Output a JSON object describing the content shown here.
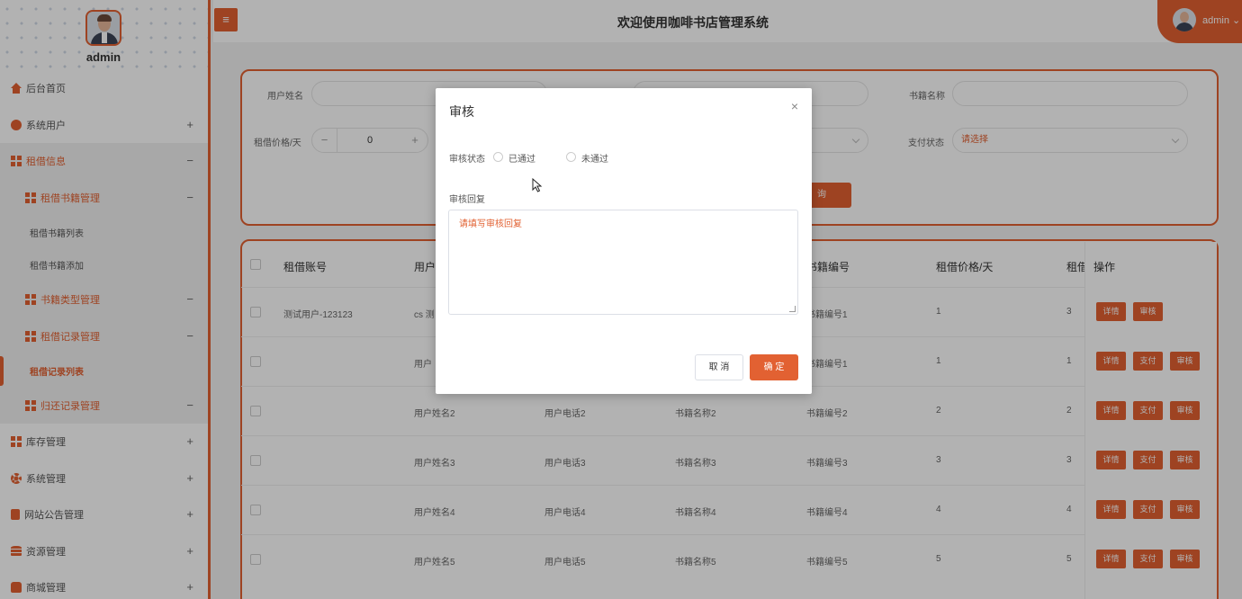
{
  "header": {
    "title": "欢迎使用咖啡书店管理系统",
    "user": "admin",
    "user_caret": "⌄",
    "menu_icon": "≡"
  },
  "sidebar": {
    "username": "admin",
    "items": [
      {
        "label": "后台首页",
        "icon": "home-icon",
        "toggle": ""
      },
      {
        "label": "系统用户",
        "icon": "user-icon",
        "toggle": "+"
      },
      {
        "label": "租借信息",
        "icon": "grid-icon",
        "toggle": "−"
      },
      {
        "label": "租借书籍管理",
        "icon": "grid-icon",
        "toggle": "−"
      },
      {
        "label": "租借书籍列表",
        "icon": "",
        "toggle": ""
      },
      {
        "label": "租借书籍添加",
        "icon": "",
        "toggle": ""
      },
      {
        "label": "书籍类型管理",
        "icon": "grid-icon",
        "toggle": "−"
      },
      {
        "label": "租借记录管理",
        "icon": "grid-icon",
        "toggle": "−"
      },
      {
        "label": "租借记录列表",
        "icon": "",
        "toggle": ""
      },
      {
        "label": "归还记录管理",
        "icon": "grid-icon",
        "toggle": "−"
      },
      {
        "label": "库存管理",
        "icon": "grid-icon",
        "toggle": "+"
      },
      {
        "label": "系统管理",
        "icon": "gear-icon",
        "toggle": "+"
      },
      {
        "label": "网站公告管理",
        "icon": "document-icon",
        "toggle": "+"
      },
      {
        "label": "资源管理",
        "icon": "database-icon",
        "toggle": "+"
      },
      {
        "label": "商城管理",
        "icon": "shop-icon",
        "toggle": "+"
      }
    ]
  },
  "search": {
    "user_name_label": "用户姓名",
    "book_name_label": "书籍名称",
    "price_label": "租借价格/天",
    "price_value": "0",
    "minus": "−",
    "plus": "+",
    "pay_status_label": "支付状态",
    "pay_status_placeholder": "请选择",
    "search_button": "询"
  },
  "table": {
    "columns": [
      "租借账号",
      "用户",
      "书籍编号",
      "租借价格/天",
      "租借",
      "操作"
    ],
    "rows": [
      {
        "account": "测试用户-123123",
        "user": "cs 测",
        "book_no": "书籍编号1",
        "price": "1",
        "days": "3",
        "phone": "",
        "book_name": "",
        "buttons": [
          "详情",
          "审核"
        ]
      },
      {
        "account": "",
        "user": "用户",
        "book_no": "书籍编号1",
        "price": "1",
        "days": "1",
        "phone": "",
        "book_name": "",
        "buttons": [
          "详情",
          "支付",
          "审核"
        ]
      },
      {
        "account": "",
        "user": "用户姓名2",
        "phone": "用户电话2",
        "book_name": "书籍名称2",
        "book_no": "书籍编号2",
        "price": "2",
        "days": "2",
        "buttons": [
          "详情",
          "支付",
          "审核"
        ]
      },
      {
        "account": "",
        "user": "用户姓名3",
        "phone": "用户电话3",
        "book_name": "书籍名称3",
        "book_no": "书籍编号3",
        "price": "3",
        "days": "3",
        "buttons": [
          "详情",
          "支付",
          "审核"
        ]
      },
      {
        "account": "",
        "user": "用户姓名4",
        "phone": "用户电话4",
        "book_name": "书籍名称4",
        "book_no": "书籍编号4",
        "price": "4",
        "days": "4",
        "buttons": [
          "详情",
          "支付",
          "审核"
        ]
      },
      {
        "account": "",
        "user": "用户姓名5",
        "phone": "用户电话5",
        "book_name": "书籍名称5",
        "book_no": "书籍编号5",
        "price": "5",
        "days": "5",
        "buttons": [
          "详情",
          "支付",
          "审核"
        ]
      }
    ]
  },
  "dialog": {
    "title": "审核",
    "close": "×",
    "status_label": "审核状态",
    "options": [
      "已通过",
      "未通过"
    ],
    "reply_label": "审核回复",
    "reply_placeholder": "请填写审核回复",
    "cancel": "取 消",
    "confirm": "确 定"
  },
  "colors": {
    "accent": "#e26132"
  }
}
